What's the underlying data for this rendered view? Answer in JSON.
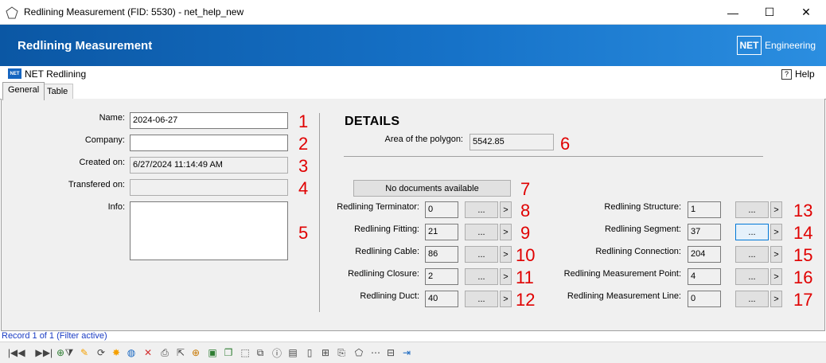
{
  "window": {
    "title": "Redlining Measurement (FID: 5530) - net_help_new",
    "minimize": "—",
    "maximize": "☐",
    "close": "✕"
  },
  "banner": {
    "title": "Redlining Measurement",
    "logo": "NET",
    "logo_text": "Engineering"
  },
  "subbar": {
    "badge": "NET",
    "title": "NET Redlining",
    "help": "Help",
    "help_icon": "?"
  },
  "tabs": [
    {
      "label": "General",
      "active": true
    },
    {
      "label": "Table",
      "active": false
    }
  ],
  "left": {
    "name_label": "Name:",
    "name_value": "2024-06-27",
    "company_label": "Company:",
    "company_value": "",
    "created_label": "Created on:",
    "created_value": "6/27/2024 11:14:49 AM",
    "transfered_label": "Transfered on:",
    "transfered_value": "",
    "info_label": "Info:",
    "info_value": ""
  },
  "details": {
    "title": "DETAILS",
    "area_label": "Area of the polygon:",
    "area_value": "5542.85",
    "documents_button": "No documents available"
  },
  "rows_left": [
    {
      "label": "Redlining Terminator:",
      "value": "0"
    },
    {
      "label": "Redlining Fitting:",
      "value": "21"
    },
    {
      "label": "Redlining Cable:",
      "value": "86"
    },
    {
      "label": "Redlining Closure:",
      "value": "2"
    },
    {
      "label": "Redlining Duct:",
      "value": "40"
    }
  ],
  "rows_right": [
    {
      "label": "Redlining Structure:",
      "value": "1"
    },
    {
      "label": "Redlining Segment:",
      "value": "37"
    },
    {
      "label": "Redlining Connection:",
      "value": "204"
    },
    {
      "label": "Redlining Measurement Point:",
      "value": "4"
    },
    {
      "label": "Redlining Measurement Line:",
      "value": "0"
    }
  ],
  "buttons": {
    "dots": "...",
    "arrow": ">"
  },
  "markers": [
    "1",
    "2",
    "3",
    "4",
    "5",
    "6",
    "7",
    "8",
    "9",
    "10",
    "11",
    "12",
    "13",
    "14",
    "15",
    "16",
    "17"
  ],
  "status": "Record 1 of 1 (Filter active)",
  "toolbar_icons": [
    {
      "name": "first-record-icon",
      "glyph": "|◀"
    },
    {
      "name": "previous-record-icon",
      "glyph": "◀"
    },
    {
      "name": "next-record-icon",
      "glyph": "▶"
    },
    {
      "name": "last-record-icon",
      "glyph": "▶|"
    },
    {
      "name": "add-filter-icon",
      "glyph": "⊕"
    },
    {
      "name": "filter-icon",
      "glyph": "⧩"
    },
    {
      "name": "edit-icon",
      "glyph": "✎"
    },
    {
      "name": "refresh-icon",
      "glyph": "⟳"
    },
    {
      "name": "new-icon",
      "glyph": "✸"
    },
    {
      "name": "web-icon",
      "glyph": "◍"
    },
    {
      "name": "delete-icon",
      "glyph": "✕"
    },
    {
      "name": "print-icon",
      "glyph": "⎙"
    },
    {
      "name": "select-icon",
      "glyph": "⇱"
    },
    {
      "name": "zoom-icon",
      "glyph": "⊕"
    },
    {
      "name": "shape-icon",
      "glyph": "▣"
    },
    {
      "name": "copy-shape-icon",
      "glyph": "❐"
    },
    {
      "name": "select-area-icon",
      "glyph": "⬚"
    },
    {
      "name": "duplicate-icon",
      "glyph": "⧉"
    },
    {
      "name": "info-icon",
      "glyph": "ⓘ"
    },
    {
      "name": "report-icon",
      "glyph": "▤"
    },
    {
      "name": "document-icon",
      "glyph": "▯"
    },
    {
      "name": "add-document-icon",
      "glyph": "⊞"
    },
    {
      "name": "attachment-icon",
      "glyph": "⎘"
    },
    {
      "name": "polygon-icon",
      "glyph": "⬠"
    },
    {
      "name": "network-icon",
      "glyph": "⋯"
    },
    {
      "name": "table-icon",
      "glyph": "⊟"
    },
    {
      "name": "exit-icon",
      "glyph": "⇥"
    }
  ],
  "colors": {
    "banner": "#1672c8",
    "marker": "#e00000",
    "status": "#1a3cc4"
  }
}
